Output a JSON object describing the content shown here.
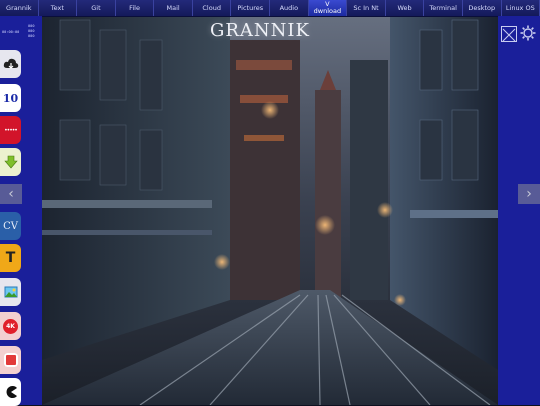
{
  "menu": {
    "tabs": [
      {
        "label": "Grannik",
        "active": false
      },
      {
        "label": "Text",
        "active": false
      },
      {
        "label": "Git",
        "active": false
      },
      {
        "label": "File",
        "active": false
      },
      {
        "label": "Mail",
        "active": false
      },
      {
        "label": "Cloud",
        "active": false
      },
      {
        "label": "Pictures",
        "active": false
      },
      {
        "label": "Audio",
        "active": false
      },
      {
        "label": "V\ndwnload",
        "active": true
      },
      {
        "label": "Sc In Nt",
        "active": false
      },
      {
        "label": "Web",
        "active": false
      },
      {
        "label": "Terminal",
        "active": false
      },
      {
        "label": "Desktop",
        "active": false
      },
      {
        "label": "Linux OS",
        "active": false
      }
    ]
  },
  "page": {
    "title": "GRANNIK"
  },
  "clock": {
    "time": "00:00:00",
    "date_lines": [
      "000",
      "000",
      "000"
    ]
  },
  "sidebar": {
    "items": [
      {
        "name": "cloud-download-button",
        "icon": "cloud-download-icon",
        "label": ""
      },
      {
        "name": "calendar-10-button",
        "icon": "calendar-icon",
        "label": "10"
      },
      {
        "name": "dots-button",
        "icon": "dots-icon",
        "label": "•••••"
      },
      {
        "name": "download-arrow-button",
        "icon": "download-arrow-icon",
        "label": ""
      },
      {
        "name": "cv-button",
        "icon": "cv-icon",
        "label": "CV"
      },
      {
        "name": "text-t-button",
        "icon": "text-t-icon",
        "label": "T"
      },
      {
        "name": "image-button",
        "icon": "image-icon",
        "label": ""
      },
      {
        "name": "4k-button",
        "icon": "4k-icon",
        "label": "4K"
      },
      {
        "name": "app-button",
        "icon": "app-icon",
        "label": ""
      },
      {
        "name": "pacman-button",
        "icon": "pacman-icon",
        "label": ""
      }
    ]
  },
  "colors": {
    "sidebar": "#1a1f9a",
    "topbar": "#1c2272",
    "active_tab": "#2a3ac0",
    "red_button": "#d2142a"
  }
}
